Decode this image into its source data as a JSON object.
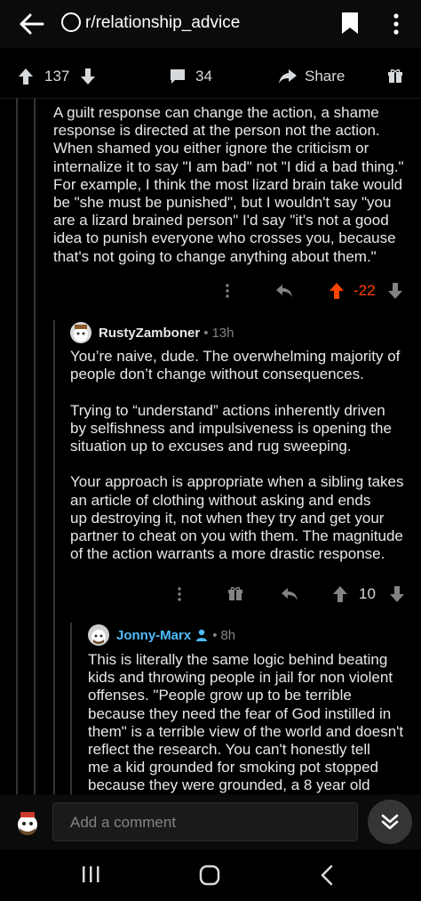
{
  "header": {
    "subreddit": "r/relationship_advice"
  },
  "post_actions": {
    "score": "137",
    "comments": "34",
    "share_label": "Share"
  },
  "comments": [
    {
      "text": "A guilt response can change the action, a shame\nresponse is directed at the person not the action.\nWhen shamed you either ignore the criticism or\ninternalize it to say \"I am bad\" not \"I did a bad thing.\"\nFor example, I think the most lizard brain take would\nbe \"she must be punished\", but I wouldn't say \"you\nare a lizard brained person\" I'd say \"it's not a good\nidea to punish everyone who crosses you, because\nthat's not going to change anything about them.\"",
      "score": "-22"
    },
    {
      "user": "RustyZamboner",
      "time": "13h",
      "text": "You’re naive, dude. The overwhelming majority of\npeople don’t change without consequences.\n\nTrying to “understand” actions inherently driven\nby selfishness and impulsiveness is opening the\nsituation up to excuses and rug sweeping.\n\nYour approach is appropriate when a sibling takes\nan article of clothing without asking and ends\nup destroying it, not when they try and get your\npartner to cheat on you with them. The magnitude\nof the action warrants a more drastic response.",
      "score": "10"
    },
    {
      "user": "Jonny-Marx",
      "time": "8h",
      "text": "This is literally the same logic behind beating\nkids and throwing people in jail for non violent\noffenses. \"People grow up to be terrible\nbecause they need the fear of God instilled in\nthem\" is a terrible view of the world and doesn't\nreflect the research. You can't honestly tell\nme a kid grounded for smoking pot stopped\nbecause they were grounded, a 8 year old"
    }
  ],
  "composer": {
    "placeholder": "Add a comment"
  },
  "colors": {
    "background": "#000000",
    "downvote_accent": "#ff4500",
    "op_username": "#4fbcff",
    "thread_line": "#343536"
  },
  "icons": [
    "back-arrow-icon",
    "subreddit-icon",
    "bookmark-icon",
    "more-vertical-icon",
    "upvote-icon",
    "downvote-icon",
    "comment-icon",
    "share-icon",
    "award-icon",
    "reply-icon",
    "op-user-icon",
    "collapse-down-icon",
    "recent-apps-icon",
    "home-icon",
    "system-back-icon"
  ]
}
